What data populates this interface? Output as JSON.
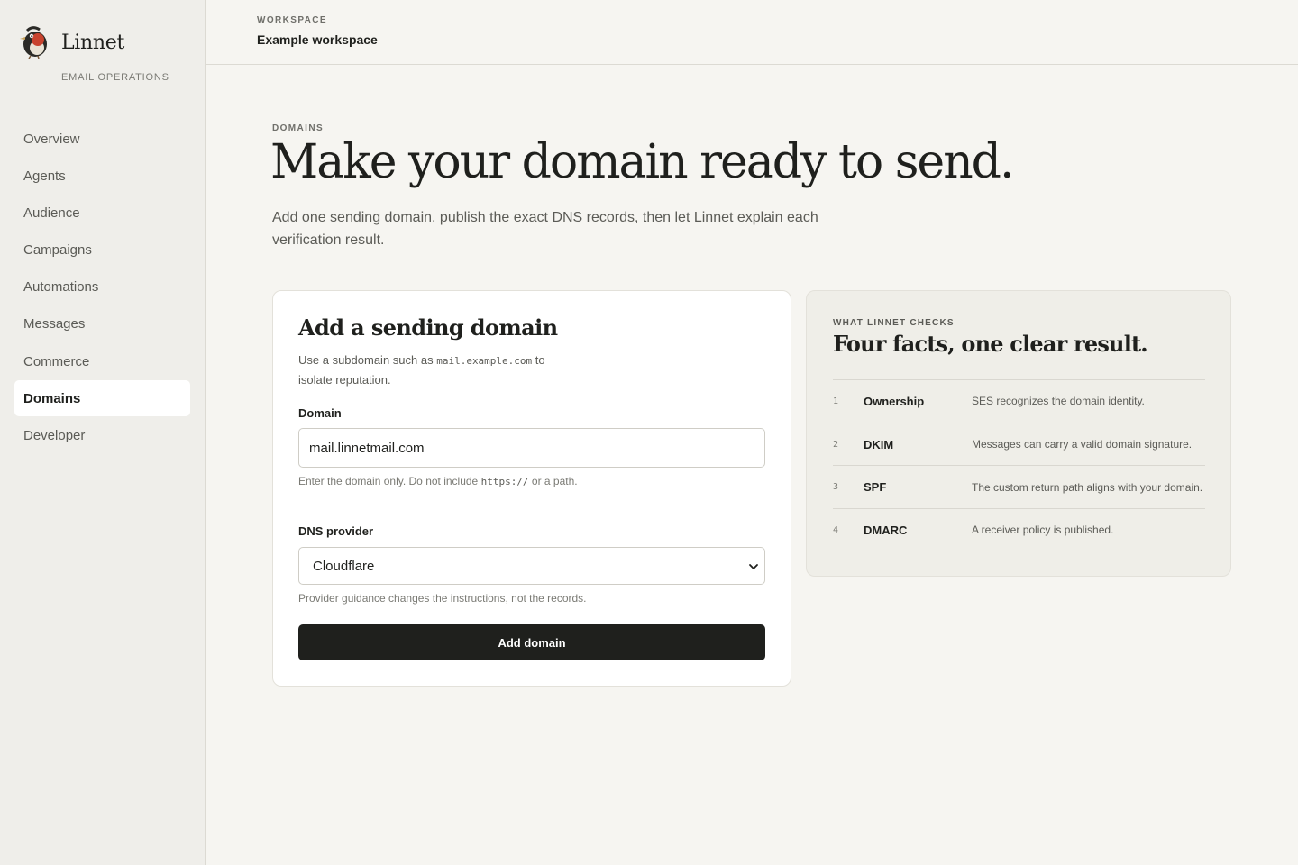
{
  "brand": {
    "name": "Linnet",
    "subtitle": "EMAIL OPERATIONS"
  },
  "sidebar": {
    "items": [
      {
        "label": "Overview",
        "active": false
      },
      {
        "label": "Agents",
        "active": false
      },
      {
        "label": "Audience",
        "active": false
      },
      {
        "label": "Campaigns",
        "active": false
      },
      {
        "label": "Automations",
        "active": false
      },
      {
        "label": "Messages",
        "active": false
      },
      {
        "label": "Commerce",
        "active": false
      },
      {
        "label": "Domains",
        "active": true
      },
      {
        "label": "Developer",
        "active": false
      }
    ]
  },
  "header": {
    "workspace_label": "WORKSPACE",
    "workspace_name": "Example workspace"
  },
  "main": {
    "eyebrow": "DOMAINS",
    "title": "Make your domain ready to send.",
    "description": "Add one sending domain, publish the exact DNS records, then let Linnet explain each verification result."
  },
  "form": {
    "title": "Add a sending domain",
    "desc_prefix": "Use a subdomain such as ",
    "desc_code": "mail.example.com",
    "desc_suffix": " to isolate reputation.",
    "domain_label": "Domain",
    "domain_value": "mail.linnetmail.com",
    "domain_hint_prefix": "Enter the domain only. Do not include ",
    "domain_hint_code": "https://",
    "domain_hint_suffix": " or a path.",
    "provider_label": "DNS provider",
    "provider_value": "Cloudflare",
    "provider_hint": "Provider guidance changes the instructions, not the records.",
    "submit_label": "Add domain"
  },
  "checks": {
    "eyebrow": "WHAT LINNET CHECKS",
    "title": "Four facts, one clear result.",
    "items": [
      {
        "num": "1",
        "name": "Ownership",
        "desc": "SES recognizes the domain identity."
      },
      {
        "num": "2",
        "name": "DKIM",
        "desc": "Messages can carry a valid domain signature."
      },
      {
        "num": "3",
        "name": "SPF",
        "desc": "The custom return path aligns with your domain."
      },
      {
        "num": "4",
        "name": "DMARC",
        "desc": "A receiver policy is published."
      }
    ]
  },
  "colors": {
    "accent_dark": "#1f201d",
    "page_bg": "#f6f5f1",
    "sidebar_bg": "#efeeea",
    "logo_red": "#c8432f"
  },
  "icons": {
    "logo": "linnet-bird-icon",
    "select": "chevron-down-icon"
  }
}
